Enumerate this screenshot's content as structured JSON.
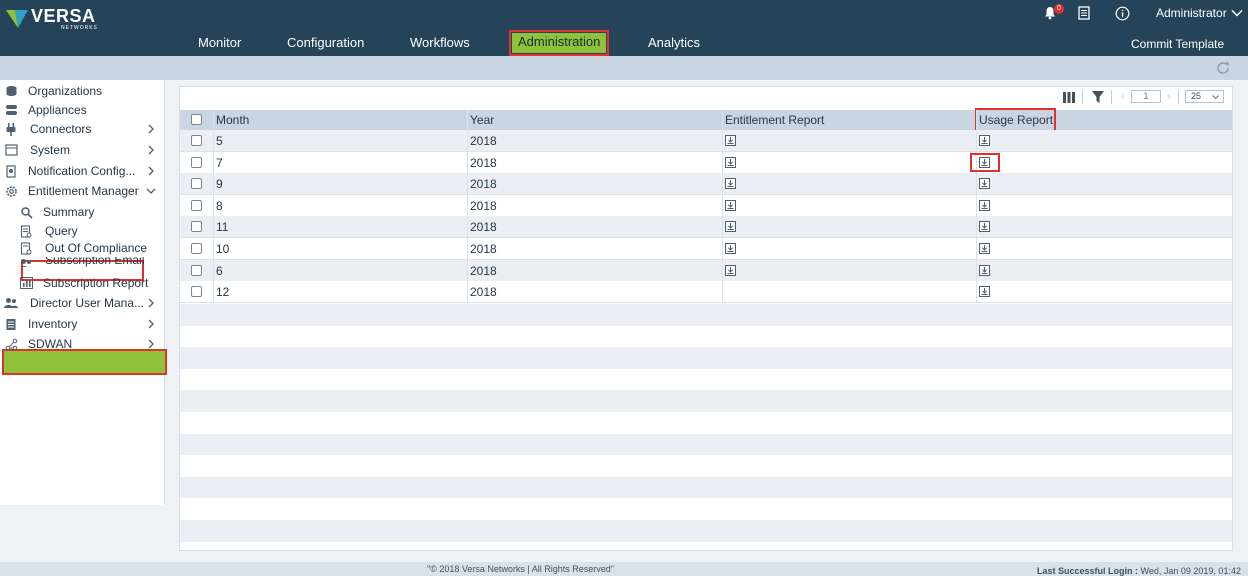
{
  "brand": {
    "name": "VERSA",
    "sub": "NETWORKS"
  },
  "nav": [
    {
      "label": "Monitor"
    },
    {
      "label": "Configuration"
    },
    {
      "label": "Workflows"
    },
    {
      "label": "Administration"
    },
    {
      "label": "Analytics"
    }
  ],
  "header": {
    "notification_count": "0",
    "user": "Administrator",
    "commit": "Commit Template"
  },
  "sidebar": {
    "items": [
      {
        "label": "Organizations",
        "icon": "organizations-icon"
      },
      {
        "label": "Appliances",
        "icon": "appliances-icon"
      },
      {
        "label": "Connectors",
        "icon": "connectors-icon"
      },
      {
        "label": "System",
        "icon": "system-icon"
      },
      {
        "label": "Notification Config...",
        "icon": "notification-config-icon"
      },
      {
        "label": "Entitlement Manager",
        "icon": "gear-icon"
      },
      {
        "label": "Summary",
        "icon": "summary-icon"
      },
      {
        "label": "Query",
        "icon": "query-icon"
      },
      {
        "label": "Out Of Compliance",
        "icon": "compliance-icon"
      },
      {
        "label": "Subscription Email",
        "icon": "users-icon"
      },
      {
        "label": "Subscription Report",
        "icon": "report-icon"
      },
      {
        "label": "Director User Mana...",
        "icon": "users-icon"
      },
      {
        "label": "Inventory",
        "icon": "inventory-icon"
      },
      {
        "label": "SDWAN",
        "icon": "sdwan-icon"
      }
    ]
  },
  "toolbar": {
    "page": "1",
    "page_size": "25"
  },
  "table": {
    "columns": [
      "Month",
      "Year",
      "Entitlement Report",
      "Usage Report"
    ],
    "rows": [
      {
        "month": "5",
        "year": "2018",
        "entitlement": true,
        "usage": true
      },
      {
        "month": "7",
        "year": "2018",
        "entitlement": true,
        "usage": true
      },
      {
        "month": "9",
        "year": "2018",
        "entitlement": true,
        "usage": true
      },
      {
        "month": "8",
        "year": "2018",
        "entitlement": true,
        "usage": true
      },
      {
        "month": "11",
        "year": "2018",
        "entitlement": true,
        "usage": true
      },
      {
        "month": "10",
        "year": "2018",
        "entitlement": true,
        "usage": true
      },
      {
        "month": "6",
        "year": "2018",
        "entitlement": true,
        "usage": true
      },
      {
        "month": "12",
        "year": "2018",
        "entitlement": false,
        "usage": true
      }
    ]
  },
  "footer": {
    "copyright": "\"© 2018 Versa Networks | All Rights Reserved\"",
    "login_label": "Last Successful Login :",
    "login_value": "Wed, Jan 09 2019, 01:42"
  },
  "colors": {
    "header": "#264459",
    "accent": "#8fc23a",
    "highlight": "#e0312f"
  }
}
